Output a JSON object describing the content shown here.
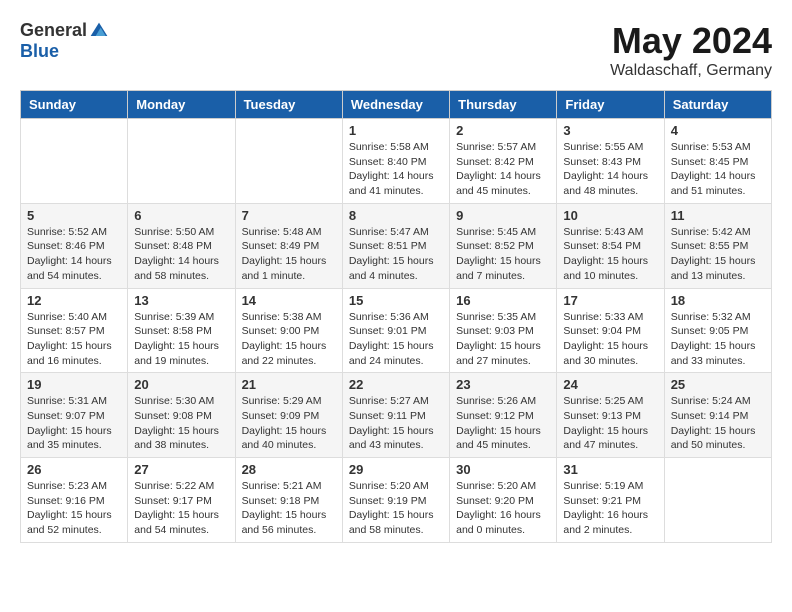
{
  "header": {
    "logo_general": "General",
    "logo_blue": "Blue",
    "month_year": "May 2024",
    "location": "Waldaschaff, Germany"
  },
  "weekdays": [
    "Sunday",
    "Monday",
    "Tuesday",
    "Wednesday",
    "Thursday",
    "Friday",
    "Saturday"
  ],
  "weeks": [
    [
      {
        "day": "",
        "info": ""
      },
      {
        "day": "",
        "info": ""
      },
      {
        "day": "",
        "info": ""
      },
      {
        "day": "1",
        "info": "Sunrise: 5:58 AM\nSunset: 8:40 PM\nDaylight: 14 hours\nand 41 minutes."
      },
      {
        "day": "2",
        "info": "Sunrise: 5:57 AM\nSunset: 8:42 PM\nDaylight: 14 hours\nand 45 minutes."
      },
      {
        "day": "3",
        "info": "Sunrise: 5:55 AM\nSunset: 8:43 PM\nDaylight: 14 hours\nand 48 minutes."
      },
      {
        "day": "4",
        "info": "Sunrise: 5:53 AM\nSunset: 8:45 PM\nDaylight: 14 hours\nand 51 minutes."
      }
    ],
    [
      {
        "day": "5",
        "info": "Sunrise: 5:52 AM\nSunset: 8:46 PM\nDaylight: 14 hours\nand 54 minutes."
      },
      {
        "day": "6",
        "info": "Sunrise: 5:50 AM\nSunset: 8:48 PM\nDaylight: 14 hours\nand 58 minutes."
      },
      {
        "day": "7",
        "info": "Sunrise: 5:48 AM\nSunset: 8:49 PM\nDaylight: 15 hours\nand 1 minute."
      },
      {
        "day": "8",
        "info": "Sunrise: 5:47 AM\nSunset: 8:51 PM\nDaylight: 15 hours\nand 4 minutes."
      },
      {
        "day": "9",
        "info": "Sunrise: 5:45 AM\nSunset: 8:52 PM\nDaylight: 15 hours\nand 7 minutes."
      },
      {
        "day": "10",
        "info": "Sunrise: 5:43 AM\nSunset: 8:54 PM\nDaylight: 15 hours\nand 10 minutes."
      },
      {
        "day": "11",
        "info": "Sunrise: 5:42 AM\nSunset: 8:55 PM\nDaylight: 15 hours\nand 13 minutes."
      }
    ],
    [
      {
        "day": "12",
        "info": "Sunrise: 5:40 AM\nSunset: 8:57 PM\nDaylight: 15 hours\nand 16 minutes."
      },
      {
        "day": "13",
        "info": "Sunrise: 5:39 AM\nSunset: 8:58 PM\nDaylight: 15 hours\nand 19 minutes."
      },
      {
        "day": "14",
        "info": "Sunrise: 5:38 AM\nSunset: 9:00 PM\nDaylight: 15 hours\nand 22 minutes."
      },
      {
        "day": "15",
        "info": "Sunrise: 5:36 AM\nSunset: 9:01 PM\nDaylight: 15 hours\nand 24 minutes."
      },
      {
        "day": "16",
        "info": "Sunrise: 5:35 AM\nSunset: 9:03 PM\nDaylight: 15 hours\nand 27 minutes."
      },
      {
        "day": "17",
        "info": "Sunrise: 5:33 AM\nSunset: 9:04 PM\nDaylight: 15 hours\nand 30 minutes."
      },
      {
        "day": "18",
        "info": "Sunrise: 5:32 AM\nSunset: 9:05 PM\nDaylight: 15 hours\nand 33 minutes."
      }
    ],
    [
      {
        "day": "19",
        "info": "Sunrise: 5:31 AM\nSunset: 9:07 PM\nDaylight: 15 hours\nand 35 minutes."
      },
      {
        "day": "20",
        "info": "Sunrise: 5:30 AM\nSunset: 9:08 PM\nDaylight: 15 hours\nand 38 minutes."
      },
      {
        "day": "21",
        "info": "Sunrise: 5:29 AM\nSunset: 9:09 PM\nDaylight: 15 hours\nand 40 minutes."
      },
      {
        "day": "22",
        "info": "Sunrise: 5:27 AM\nSunset: 9:11 PM\nDaylight: 15 hours\nand 43 minutes."
      },
      {
        "day": "23",
        "info": "Sunrise: 5:26 AM\nSunset: 9:12 PM\nDaylight: 15 hours\nand 45 minutes."
      },
      {
        "day": "24",
        "info": "Sunrise: 5:25 AM\nSunset: 9:13 PM\nDaylight: 15 hours\nand 47 minutes."
      },
      {
        "day": "25",
        "info": "Sunrise: 5:24 AM\nSunset: 9:14 PM\nDaylight: 15 hours\nand 50 minutes."
      }
    ],
    [
      {
        "day": "26",
        "info": "Sunrise: 5:23 AM\nSunset: 9:16 PM\nDaylight: 15 hours\nand 52 minutes."
      },
      {
        "day": "27",
        "info": "Sunrise: 5:22 AM\nSunset: 9:17 PM\nDaylight: 15 hours\nand 54 minutes."
      },
      {
        "day": "28",
        "info": "Sunrise: 5:21 AM\nSunset: 9:18 PM\nDaylight: 15 hours\nand 56 minutes."
      },
      {
        "day": "29",
        "info": "Sunrise: 5:20 AM\nSunset: 9:19 PM\nDaylight: 15 hours\nand 58 minutes."
      },
      {
        "day": "30",
        "info": "Sunrise: 5:20 AM\nSunset: 9:20 PM\nDaylight: 16 hours\nand 0 minutes."
      },
      {
        "day": "31",
        "info": "Sunrise: 5:19 AM\nSunset: 9:21 PM\nDaylight: 16 hours\nand 2 minutes."
      },
      {
        "day": "",
        "info": ""
      }
    ]
  ]
}
